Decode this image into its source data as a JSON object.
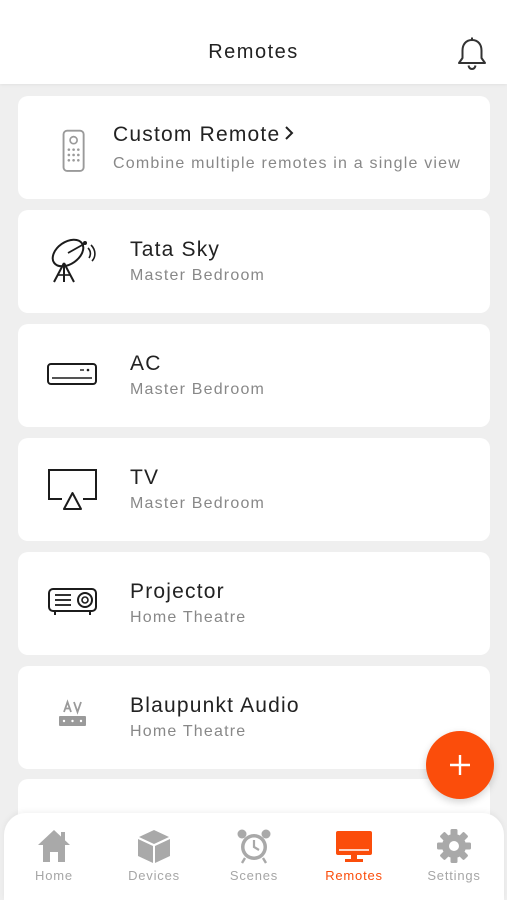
{
  "colors": {
    "accent": "#fb4d0b",
    "icon_gray": "#a9a9a9",
    "background": "#efefef"
  },
  "header": {
    "title": "Remotes",
    "notification_icon": "bell-icon"
  },
  "custom_remote": {
    "title": "Custom Remote",
    "subtitle": "Combine multiple remotes in a single view",
    "icon": "remote-control-icon"
  },
  "remotes": [
    {
      "name": "Tata Sky",
      "room": "Master Bedroom",
      "icon": "satellite-dish-icon"
    },
    {
      "name": "AC",
      "room": "Master Bedroom",
      "icon": "air-conditioner-icon"
    },
    {
      "name": "TV",
      "room": "Master Bedroom",
      "icon": "tv-icon"
    },
    {
      "name": "Projector",
      "room": "Home Theatre",
      "icon": "projector-icon"
    },
    {
      "name": "Blaupunkt Audio",
      "room": "Home Theatre",
      "icon": "av-receiver-icon"
    }
  ],
  "fab": {
    "icon": "plus-icon"
  },
  "tabs": [
    {
      "label": "Home",
      "icon": "home-icon",
      "active": false
    },
    {
      "label": "Devices",
      "icon": "cube-icon",
      "active": false
    },
    {
      "label": "Scenes",
      "icon": "alarm-clock-icon",
      "active": false
    },
    {
      "label": "Remotes",
      "icon": "monitor-icon",
      "active": true
    },
    {
      "label": "Settings",
      "icon": "gear-icon",
      "active": false
    }
  ]
}
